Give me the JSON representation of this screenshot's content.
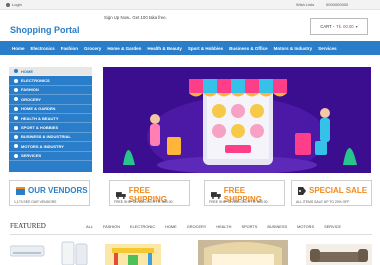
{
  "topbar": {
    "login_label": "Login",
    "links": [
      "Wish Lists",
      "0000000000"
    ]
  },
  "header": {
    "logo": "Shopping Portal",
    "promo": "Sign Up Now.. Get 100 taka free.",
    "cart_label": "CART -",
    "cart_amount": "Tk. 00.00"
  },
  "nav": {
    "items": [
      "Home",
      "Electronics",
      "Fashion",
      "Grocery",
      "Home & Garden",
      "Health & Beauty",
      "Sport & Hobbies",
      "Business & Office",
      "Motors & Industry",
      "Services"
    ]
  },
  "sidebar": {
    "items": [
      "HOME",
      "ELECTRONICS",
      "FASHION",
      "GROCERY",
      "HOME & GARDEN",
      "HEALTH & BEAUTY",
      "SPORT & HOBBIES",
      "BUSINESS & INDUSTRIAL",
      "MOTORS & INDUSTRY",
      "SERVICES"
    ]
  },
  "features": [
    {
      "title": "OUR VENDORS",
      "sub": "1,173 SEE OUR VENDORS",
      "color": "#2a7ec9"
    },
    {
      "title": "FREE SHIPPING",
      "sub": "FREE SHIP ON 800 OVER TK. 600.00",
      "color": "#f08a1c"
    },
    {
      "title": "FREE SHIPPING",
      "sub": "FREE SHIP ON 800 OVER TK. 600.00",
      "color": "#f08a1c"
    },
    {
      "title": "SPECIAL SALE",
      "sub": "ALL ITEMS SALE UP TO 20% OFF",
      "color": "#f08a1c"
    }
  ],
  "featured": {
    "title": "FEATURED",
    "tabs": [
      "ALL",
      "FASHION",
      "ELECTRONIC",
      "HOME",
      "GROCERY",
      "HEALTH",
      "SPORTS",
      "BUSINESS",
      "MOTORS",
      "SERVICE"
    ]
  },
  "colors": {
    "brand": "#2a7ec9",
    "accent": "#f08a1c",
    "banner_bg": "#3a0e8e"
  }
}
